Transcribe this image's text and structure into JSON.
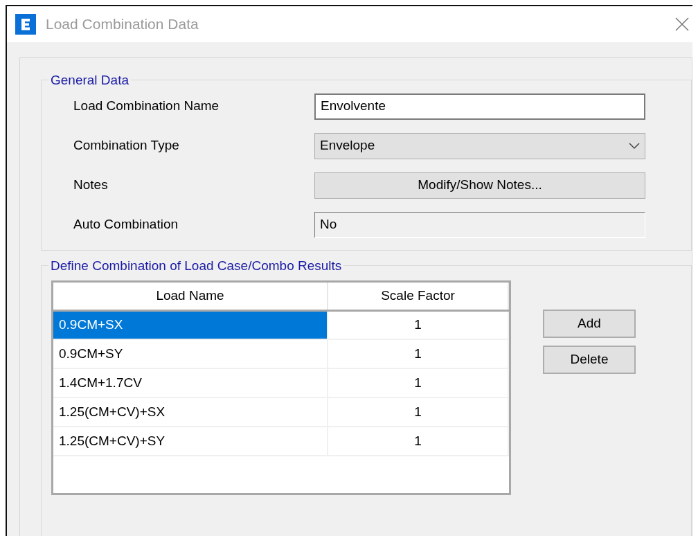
{
  "window": {
    "title": "Load Combination Data"
  },
  "general_data": {
    "title": "General Data",
    "fields": [
      {
        "kind": "text",
        "label": "Load Combination Name",
        "value": "Envolvente"
      },
      {
        "kind": "dropdown",
        "label": "Combination Type",
        "value": "Envelope"
      },
      {
        "kind": "button",
        "label": "Notes",
        "value": "Modify/Show Notes..."
      },
      {
        "kind": "readonly",
        "label": "Auto Combination",
        "value": "No"
      }
    ]
  },
  "combination": {
    "title": "Define Combination of Load Case/Combo Results",
    "table": {
      "columns": [
        "Load Name",
        "Scale Factor"
      ],
      "rows": [
        {
          "load_name": "0.9CM+SX",
          "scale_factor": "1",
          "selected": true
        },
        {
          "load_name": "0.9CM+SY",
          "scale_factor": "1",
          "selected": false
        },
        {
          "load_name": "1.4CM+1.7CV",
          "scale_factor": "1",
          "selected": false
        },
        {
          "load_name": "1.25(CM+CV)+SX",
          "scale_factor": "1",
          "selected": false
        },
        {
          "load_name": "1.25(CM+CV)+SY",
          "scale_factor": "1",
          "selected": false
        }
      ]
    },
    "buttons": [
      "Add",
      "Delete"
    ]
  }
}
